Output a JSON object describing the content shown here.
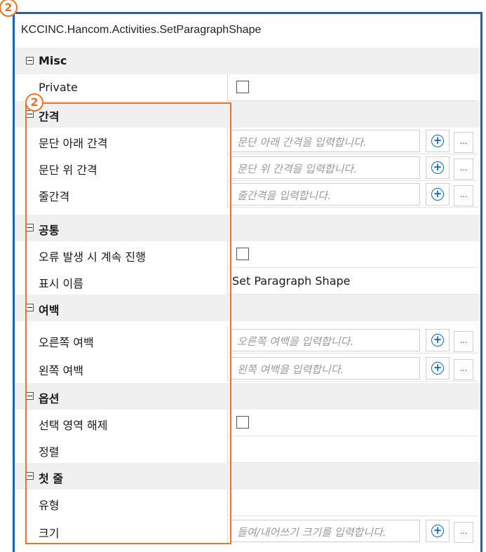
{
  "badge_top": "2",
  "badge_inner": "2",
  "title": "KCCINC.Hancom.Activities.SetParagraphShape",
  "categories": {
    "misc": "Misc",
    "spacing": "간격",
    "common": "공통",
    "margin": "여백",
    "options": "옵션",
    "first_line": "첫 줄"
  },
  "props": {
    "private": "Private",
    "below_spacing": "문단 아래 간격",
    "below_spacing_ph": "문단 아래 간격을 입력합니다.",
    "above_spacing": "문단 위 간격",
    "above_spacing_ph": "문단 위 간격을 입력합니다.",
    "line_spacing": "줄간격",
    "line_spacing_ph": "줄간격을 입력합니다.",
    "continue_on_error": "오류 발생 시 계속 진행",
    "display_name": "표시 이름",
    "display_name_value": "Set Paragraph Shape",
    "right_margin": "오른쪽 여백",
    "right_margin_ph": "오른쪽 여백을 입력합니다.",
    "left_margin": "왼쪽 여백",
    "left_margin_ph": "왼쪽 여백을 입력합니다.",
    "deselect": "선택 영역 해제",
    "align": "정렬",
    "type": "유형",
    "size": "크기",
    "size_ph": "들여/내어쓰기 크기를 입력합니다."
  },
  "buttons": {
    "add_symbol": "+",
    "more_symbol": "..."
  },
  "colors": {
    "frame": "#1565c0",
    "highlight": "#e8742a",
    "category_bg": "#f0f0f0"
  }
}
